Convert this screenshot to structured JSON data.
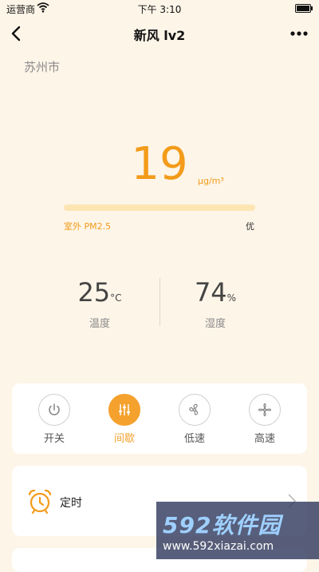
{
  "status_bar": {
    "carrier": "运营商",
    "time": "下午 3:10"
  },
  "nav": {
    "title": "新风 lv2"
  },
  "location": {
    "city": "苏州市"
  },
  "air": {
    "pm_value": "19",
    "pm_unit": "μg/m³",
    "pm_label": "室外 PM2.5",
    "grade": "优"
  },
  "metrics": {
    "temperature": {
      "value": "25",
      "unit": "°C",
      "label": "温度"
    },
    "humidity": {
      "value": "74",
      "unit": "%",
      "label": "湿度"
    }
  },
  "modes": [
    {
      "label": "开关",
      "icon": "power-icon",
      "active": false
    },
    {
      "label": "间歇",
      "icon": "sliders-icon",
      "active": true
    },
    {
      "label": "低速",
      "icon": "fan-low-icon",
      "active": false
    },
    {
      "label": "高速",
      "icon": "fan-high-icon",
      "active": false
    }
  ],
  "timer": {
    "label": "定时",
    "icon": "alarm-clock-icon"
  },
  "watermark": {
    "title": "592软件园",
    "url": "www.592xiazai.com"
  },
  "colors": {
    "accent": "#f39b1a",
    "background": "#fdf5e8",
    "bar": "#fde5b3"
  }
}
